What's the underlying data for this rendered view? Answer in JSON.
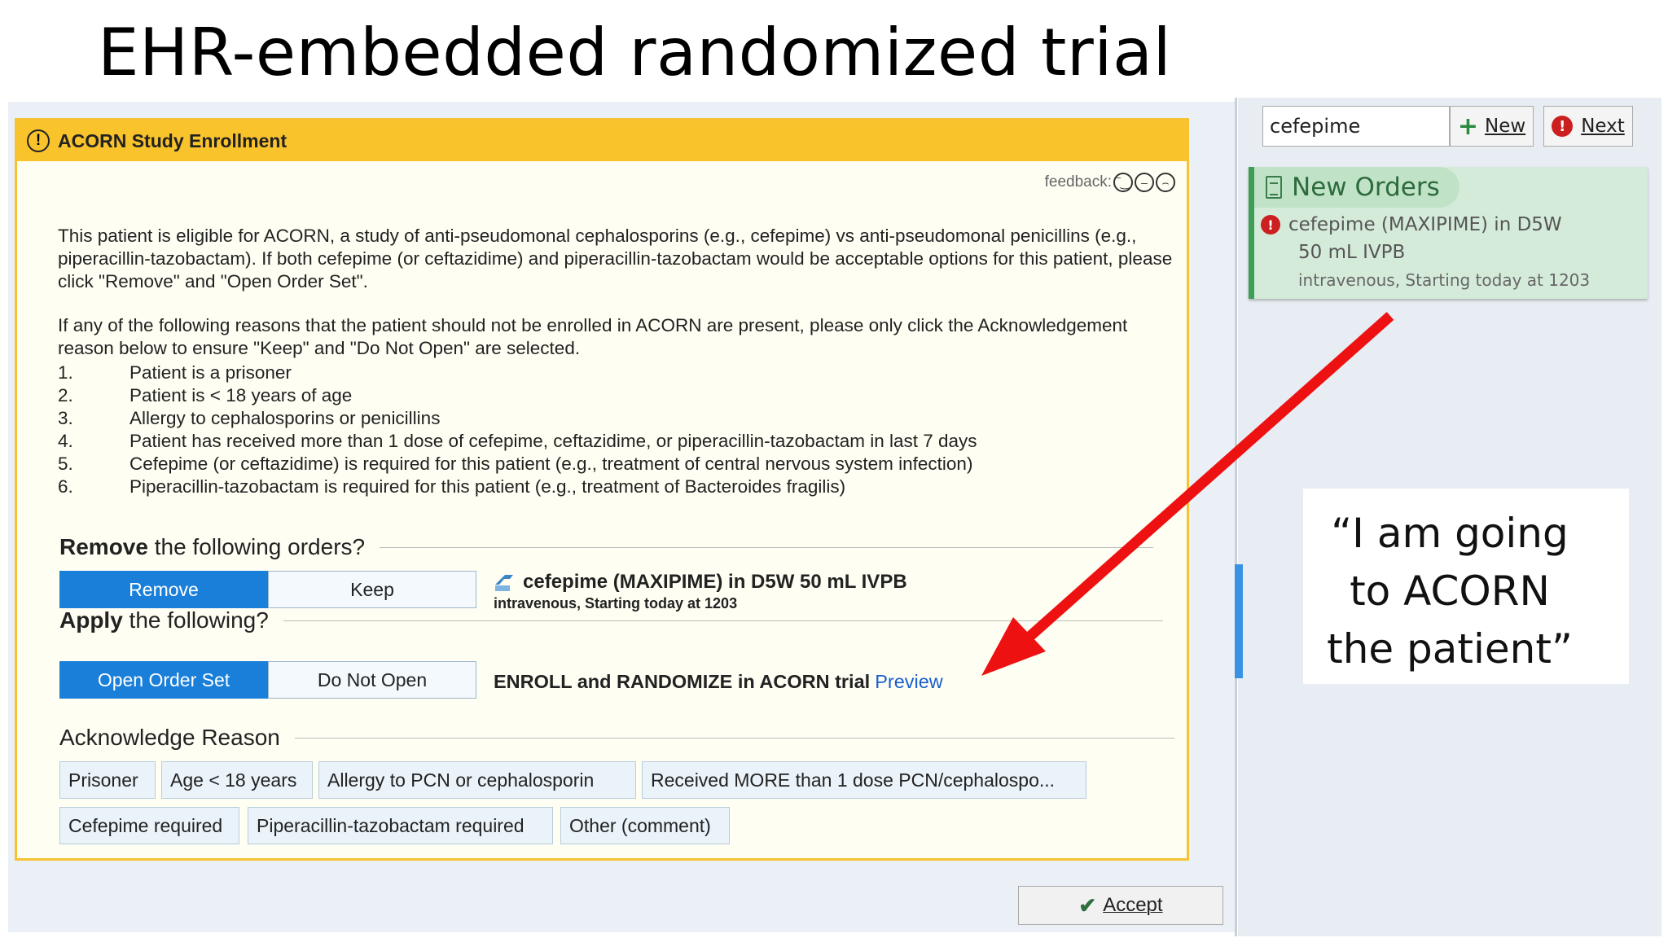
{
  "slide": {
    "title": "EHR-embedded randomized trial"
  },
  "bpa": {
    "header_title": "ACORN Study Enrollment",
    "header_icon": "alert-circle-icon",
    "feedback_label": "feedback:",
    "paragraph1": "This patient is eligible for ACORN, a study of anti-pseudomonal cephalosporins (e.g., cefepime) vs anti-pseudomonal penicillins (e.g., piperacillin-tazobactam).  If both cefepime (or ceftazidime) and piperacillin-tazobactam would be acceptable options for this patient, please click \"Remove\" and \"Open Order Set\".",
    "paragraph2": "If any of the following reasons that the patient should not be enrolled in ACORN are present, please only click the Acknowledgement reason below to ensure \"Keep\" and \"Do Not Open\" are selected.",
    "reasons": [
      {
        "num": "1.",
        "text": "Patient is a prisoner"
      },
      {
        "num": "2.",
        "text": "Patient is < 18 years of age"
      },
      {
        "num": "3.",
        "text": "Allergy to cephalosporins or penicillins"
      },
      {
        "num": "4.",
        "text": "Patient has received more than 1 dose of cefepime, ceftazidime, or piperacillin-tazobactam in last 7 days"
      },
      {
        "num": "5.",
        "text": "Cefepime (or ceftazidime) is required for this patient (e.g., treatment of central nervous system infection)"
      },
      {
        "num": "6.",
        "text": "Piperacillin-tazobactam is required for this patient (e.g., treatment of Bacteroides fragilis)"
      }
    ],
    "remove_section": {
      "bold": "Remove",
      "rest": " the following orders?"
    },
    "remove_button": "Remove",
    "keep_button": "Keep",
    "order_name": "cefepime (MAXIPIME) in D5W 50 mL IVPB",
    "order_sub": "intravenous, Starting today at 1203",
    "apply_section": {
      "bold": "Apply",
      "rest": " the following?"
    },
    "open_order_set_button": "Open Order Set",
    "do_not_open_button": "Do Not Open",
    "order_set_name": "ENROLL and RANDOMIZE in ACORN trial",
    "preview_link": "Preview",
    "ack_section": "Acknowledge Reason",
    "ack_buttons": [
      "Prisoner",
      "Age < 18 years",
      "Allergy to PCN or cephalosporin",
      "Received MORE than 1 dose PCN/cephalospo...",
      "Cefepime required",
      "Piperacillin-tazobactam required",
      "Other (comment)"
    ],
    "accept_button": "Accept"
  },
  "sidebar": {
    "search_value": "cefepime",
    "new_button": "New",
    "next_button": "Next",
    "new_orders_title": "New Orders",
    "order_line1": "cefepime (MAXIPIME) in D5W",
    "order_line2": "50 mL IVPB",
    "order_line3": "intravenous, Starting today at 1203"
  },
  "quote": [
    "“I am going",
    "to ACORN",
    "the patient”"
  ],
  "colors": {
    "arrow": "#ee1111",
    "header": "#f9c32c",
    "toggle_on": "#1a7fd9",
    "new_orders_green": "#3f9e56"
  }
}
